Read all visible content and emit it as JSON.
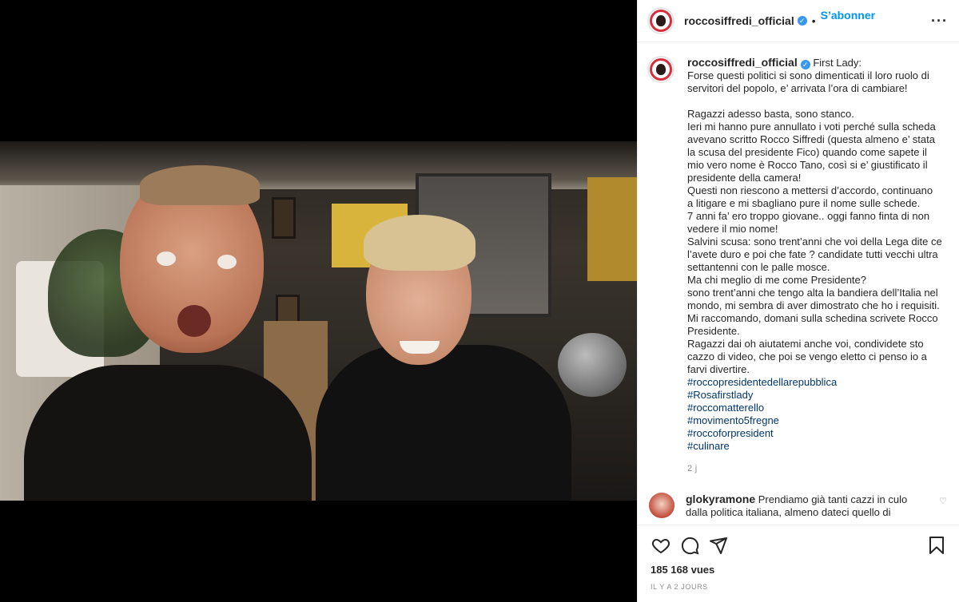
{
  "post": {
    "username": "roccosiffredi_official",
    "follow_label": "S’abonner",
    "more_label": "···"
  },
  "caption": {
    "username": "roccosiffredi_official",
    "lines": [
      "First Lady:",
      "Forse questi politici si sono dimenticati il loro ruolo di",
      "servitori del popolo, e’ arrivata l’ora di cambiare!",
      "",
      "Ragazzi adesso basta, sono stanco.",
      "Ieri mi hanno pure annullato i voti perché sulla scheda",
      "avevano scritto Rocco Siffredi (questa almeno e’ stata",
      "la scusa del presidente Fico) quando come sapete il",
      "mio vero nome è Rocco Tano, così si e’ giustificato il",
      "presidente della camera!",
      "Questi non riescono a mettersi d’accordo, continuano",
      "a litigare e mi sbagliano pure il nome sulle schede.",
      "7 anni fa’ ero troppo giovane.. oggi fanno finta di non",
      "vedere il mio nome!",
      "Salvini scusa: sono trent’anni che voi della Lega dite ce",
      "l’avete duro e poi che fate ? candidate tutti vecchi ultra",
      "settantenni con le palle mosce.",
      "Ma chi meglio di me come Presidente?",
      "sono trent’anni che tengo alta la bandiera dell’Italia nel",
      "mondo, mi sembra di aver dimostrato che ho i requisiti.",
      "Mi raccomando, domani sulla schedina scrivete Rocco",
      "Presidente.",
      "Ragazzi dai oh aiutatemi anche voi, condividete sto",
      "cazzo di video, che poi se vengo eletto ci penso io a",
      "farvi divertire."
    ],
    "hashtags": [
      "#roccopresidentedellarepubblica",
      "#Rosafirstlady",
      "#roccomatterello",
      "#movimento5fregne",
      "#roccoforpresident",
      "#culinare"
    ],
    "age": "2 j"
  },
  "comment": {
    "username": "glokyramone",
    "text_line1": "Prendiamo già tanti cazzi in culo",
    "text_line2": "dalla politica italiana, almeno dateci quello di"
  },
  "actions": {
    "like_icon": "heart-icon",
    "comment_icon": "comment-icon",
    "share_icon": "share-icon",
    "save_icon": "bookmark-icon"
  },
  "stats": {
    "views": "185 168 vues",
    "posted": "IL Y A 2 JOURS"
  },
  "colors": {
    "accent": "#0095f6",
    "verified": "#3897f0",
    "hashtag": "#00376b",
    "muted": "#8e8e8e"
  }
}
